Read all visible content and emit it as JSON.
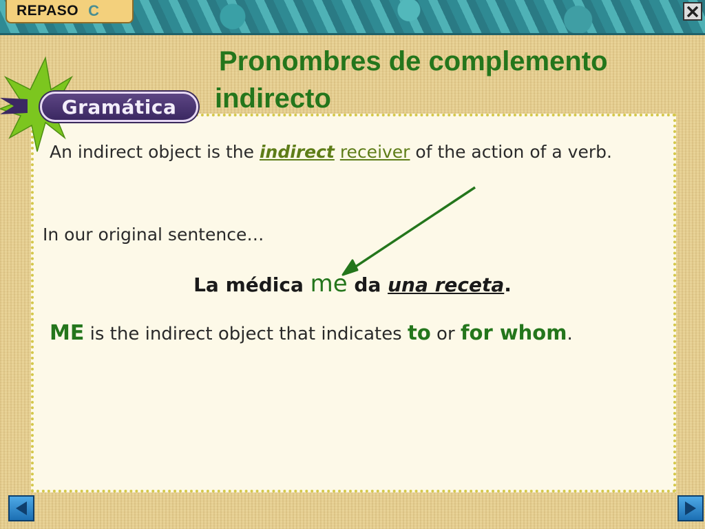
{
  "header": {
    "section_label": "REPASO",
    "section_letter": "C",
    "close_icon": "close-x-icon"
  },
  "badge": {
    "label": "Gramática",
    "star_icon": "starburst-icon"
  },
  "title": {
    "line1": "Pronombres de complemento",
    "line2": "indirecto"
  },
  "content": {
    "definition": {
      "before": "An indirect object is the ",
      "highlight_1": "indirect",
      "space": " ",
      "highlight_2": "receiver",
      "after": " of the action of a verb."
    },
    "intro": "In our original sentence…",
    "example": {
      "part1": "La médica ",
      "pronoun": "me",
      "part2": " da ",
      "object": "una receta",
      "end": "."
    },
    "explanation": {
      "subject": "ME",
      "mid": " is the indirect object that indicates ",
      "to": "to",
      "or": " or ",
      "whom": "for whom",
      "end": "."
    }
  },
  "navigation": {
    "prev_icon": "triangle-left-icon",
    "next_icon": "triangle-right-icon"
  },
  "colors": {
    "title_green": "#24761c",
    "badge_purple": "#4a3570",
    "panel_border": "#d4c84a",
    "nav_blue": "#2a86cc"
  }
}
